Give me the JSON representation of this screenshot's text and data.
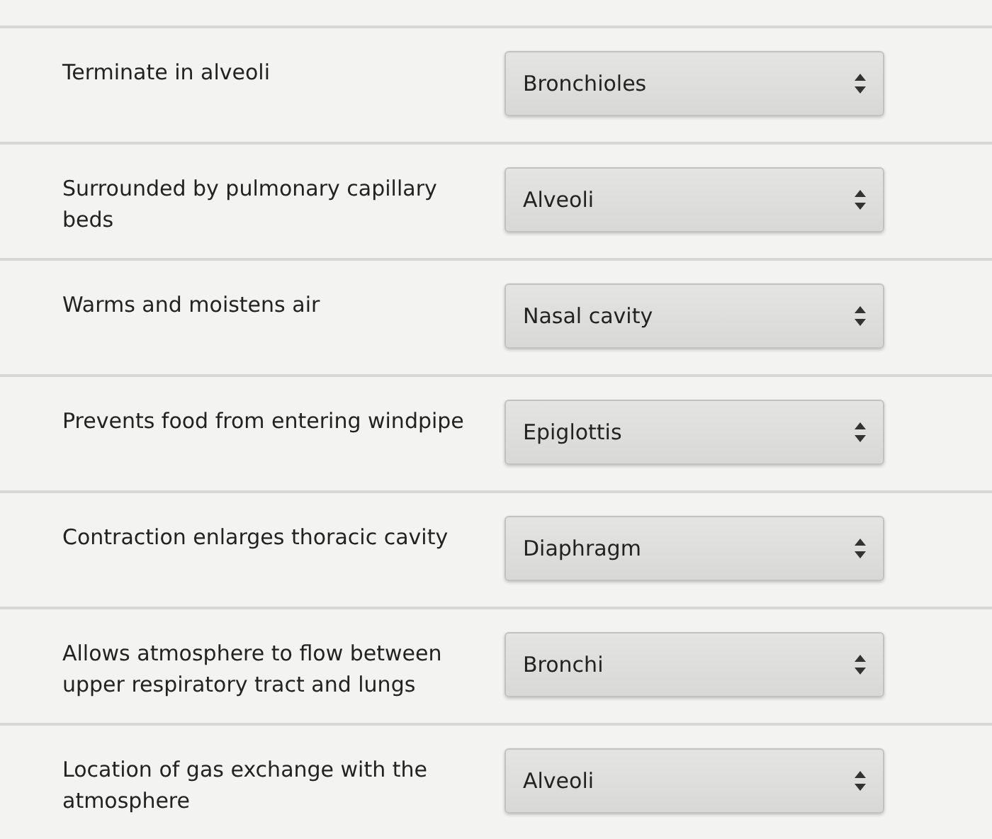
{
  "rows": [
    {
      "prompt": "Terminate in alveoli",
      "answer": "Bronchioles"
    },
    {
      "prompt": "Surrounded by pulmonary capillary beds",
      "answer": "Alveoli"
    },
    {
      "prompt": "Warms and moistens air",
      "answer": "Nasal cavity"
    },
    {
      "prompt": "Prevents food from entering windpipe",
      "answer": "Epiglottis"
    },
    {
      "prompt": "Contraction enlarges thoracic cavity",
      "answer": "Diaphragm"
    },
    {
      "prompt": "Allows atmosphere to flow between upper respiratory tract and lungs",
      "answer": "Bronchi"
    },
    {
      "prompt": "Location of gas exchange with the atmosphere",
      "answer": "Alveoli"
    }
  ]
}
